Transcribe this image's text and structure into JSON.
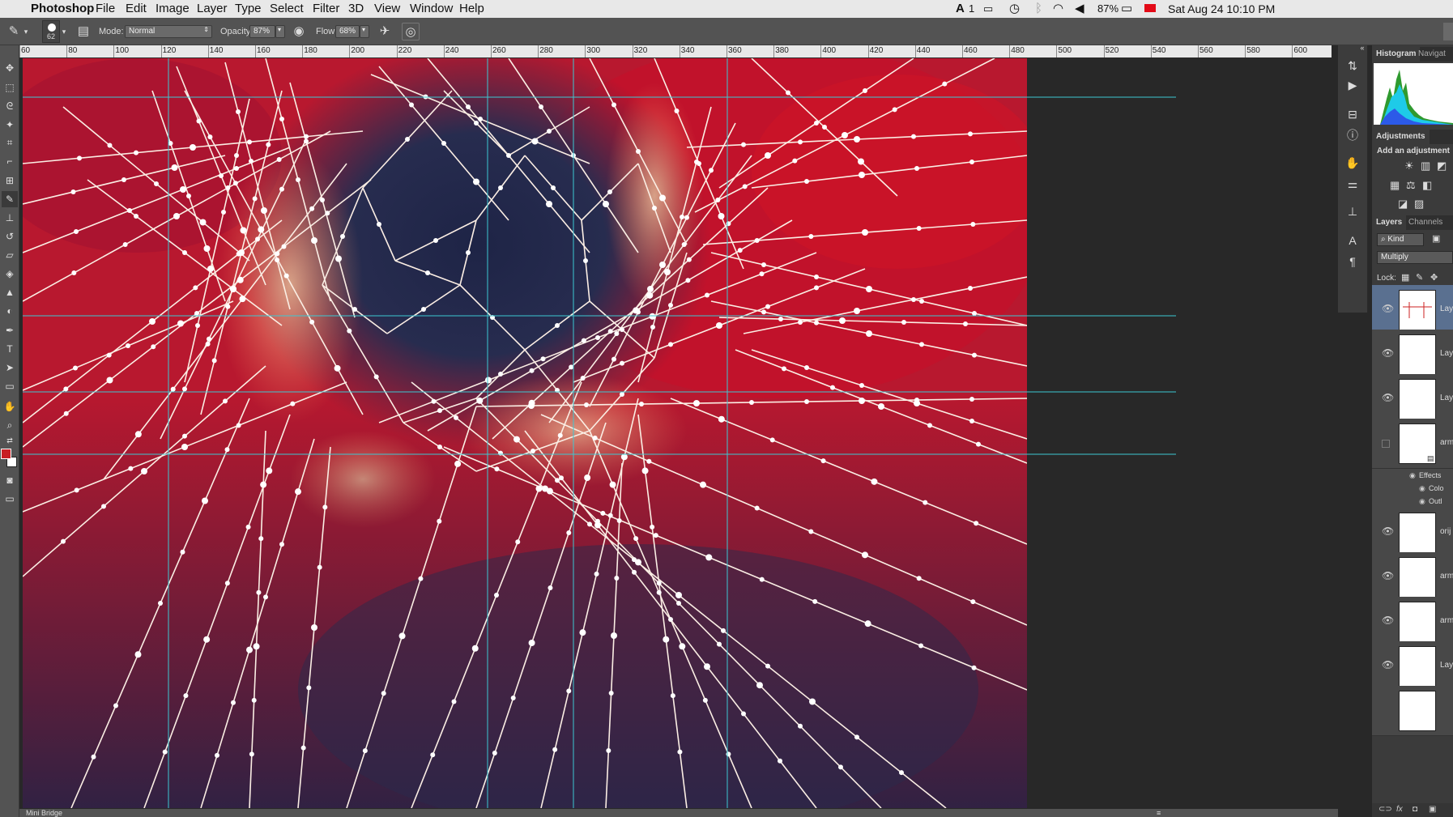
{
  "menubar": {
    "apple_icon": "apple-icon",
    "app_name": "Photoshop",
    "menus": [
      "File",
      "Edit",
      "Image",
      "Layer",
      "Type",
      "Select",
      "Filter",
      "3D",
      "View",
      "Window",
      "Help"
    ],
    "adobe_status": "1",
    "battery": "87%",
    "datetime": "Sat Aug 24  10:10 PM"
  },
  "options": {
    "brush_size": "62",
    "mode_label": "Mode:",
    "mode_value": "Normal",
    "opacity_label": "Opacity:",
    "opacity_value": "87%",
    "flow_label": "Flow:",
    "flow_value": "68%"
  },
  "ruler": {
    "ticks": [
      "60",
      "80",
      "100",
      "120",
      "140",
      "160",
      "180",
      "200",
      "220",
      "240",
      "260",
      "280",
      "300",
      "320",
      "340",
      "360",
      "380",
      "400",
      "420",
      "440",
      "460",
      "480",
      "500",
      "520",
      "540",
      "560",
      "580",
      "600"
    ]
  },
  "panels": {
    "histogram_tab": "Histogram",
    "navigator_tab": "Navigat",
    "adjustments_tab": "Adjustments",
    "adjustments_hint": "Add an adjustment",
    "layers_tab": "Layers",
    "channels_tab": "Channels",
    "kind_filter": "Kind",
    "blend_mode": "Multiply",
    "lock_label": "Lock:",
    "effects_label": "Effects",
    "effect_items": [
      "Colo",
      "Outl"
    ]
  },
  "layers": [
    {
      "name": "Lay",
      "visible": true,
      "selected": true
    },
    {
      "name": "Lay",
      "visible": true,
      "selected": false
    },
    {
      "name": "Lay",
      "visible": true,
      "selected": false
    },
    {
      "name": "arm",
      "visible": false,
      "selected": false
    },
    {
      "name": "orij",
      "visible": true,
      "selected": false
    },
    {
      "name": "arm",
      "visible": true,
      "selected": false
    },
    {
      "name": "arm",
      "visible": true,
      "selected": false
    },
    {
      "name": "Lay",
      "visible": true,
      "selected": false
    }
  ],
  "statusbar": {
    "mini_bridge": "Mini Bridge"
  },
  "colors": {
    "foreground": "#c81e23",
    "background": "#ffffff",
    "guide": "#3cc8d2",
    "canvas_red": "#c2182d",
    "canvas_navy": "#202848"
  }
}
